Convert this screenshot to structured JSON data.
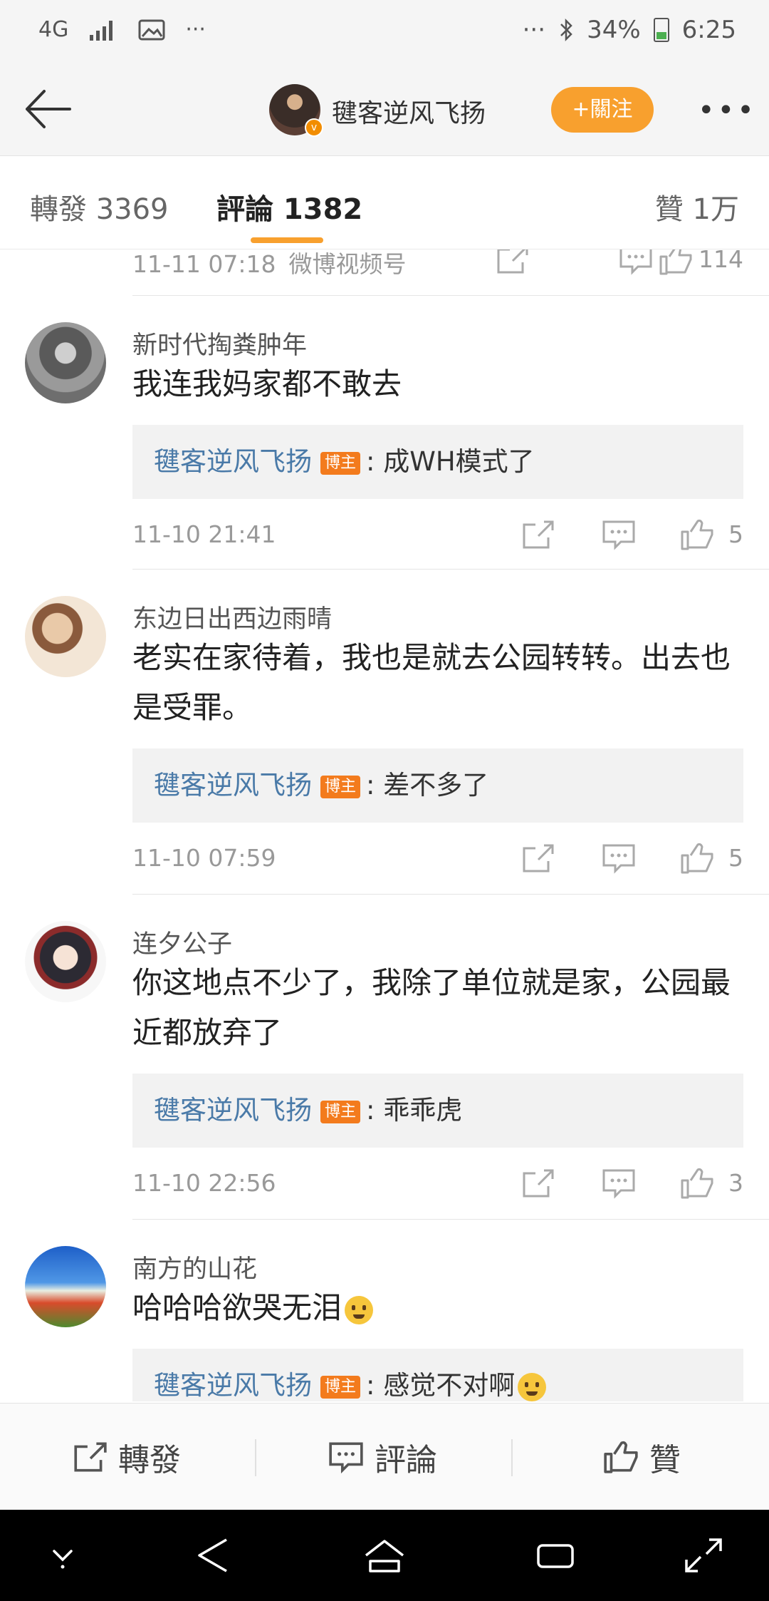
{
  "status_bar": {
    "network": "4G",
    "dots_left": "···",
    "dots_right": "···",
    "battery": "34%",
    "time": "6:25"
  },
  "nav": {
    "title": "毽客逆风飞扬",
    "follow_label": "+關注",
    "more_label": "•••",
    "verified_mark": "v"
  },
  "tabs": {
    "reposts": "轉發 3369",
    "comments": "評論 1382",
    "likes": "贊 1万"
  },
  "top_meta": {
    "time": "11-11 07:18",
    "source": "微博视频号",
    "likes": "114"
  },
  "comments": [
    {
      "name": "新时代掏粪肿年",
      "text": "我连我妈家都不敢去",
      "reply_name": "毽客逆风飞扬",
      "reply_badge": "博主",
      "reply_text": ": 成WH模式了",
      "time": "11-10 21:41",
      "likes": "5"
    },
    {
      "name": "东边日出西边雨晴",
      "text": "老实在家待着，我也是就去公园转转。出去也是受罪。",
      "reply_name": "毽客逆风飞扬",
      "reply_badge": "博主",
      "reply_text": ": 差不多了",
      "time": "11-10 07:59",
      "likes": "5"
    },
    {
      "name": "连夕公子",
      "text": "你这地点不少了，我除了单位就是家，公园最近都放弃了",
      "reply_name": "毽客逆风飞扬",
      "reply_badge": "博主",
      "reply_text": ": 乖乖虎",
      "time": "11-10 22:56",
      "likes": "3"
    },
    {
      "name": "南方的山花",
      "text": "哈哈哈欲哭无泪",
      "reply_name": "毽客逆风飞扬",
      "reply_badge": "博主",
      "reply_text": ": 感觉不对啊"
    }
  ],
  "action_bar": {
    "repost": "轉發",
    "comment": "評論",
    "like": "贊"
  },
  "colors": {
    "accent": "#f8a02e",
    "link": "#4a7aa8",
    "badge": "#f37b1d"
  }
}
